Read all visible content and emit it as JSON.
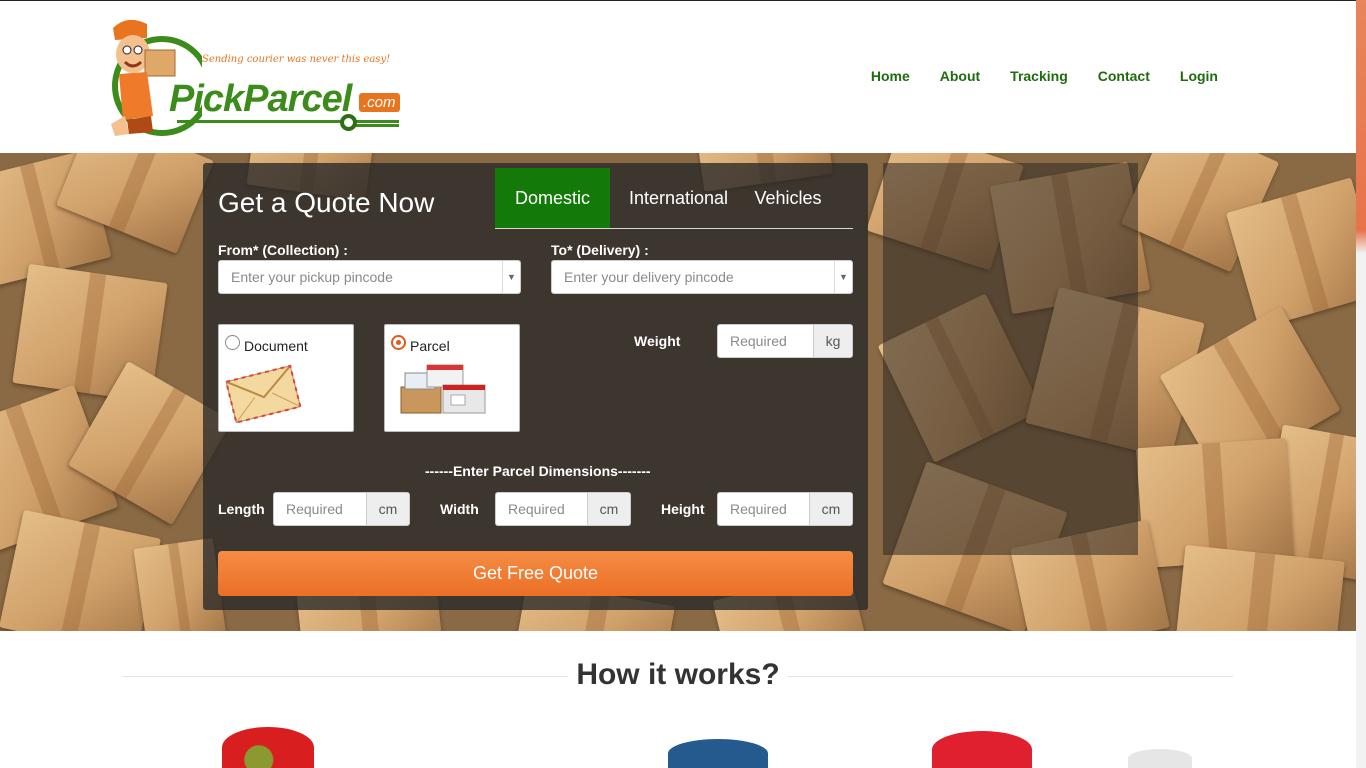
{
  "header": {
    "logo": {
      "tagline": "Sending courier was never this easy!",
      "brand": "PickParcel",
      "domain_suffix": ".com",
      "colors": {
        "green": "#3c8c1c",
        "orange": "#e8741f"
      }
    },
    "nav": [
      "Home",
      "About",
      "Tracking",
      "Contact",
      "Login"
    ]
  },
  "quote": {
    "title": "Get a Quote Now",
    "tabs": [
      "Domestic",
      "International",
      "Vehicles"
    ],
    "active_tab": "Domestic",
    "from": {
      "label": "From* (Collection) :",
      "placeholder": "Enter your pickup pincode"
    },
    "to": {
      "label": "To* (Delivery) :",
      "placeholder": "Enter your delivery pincode"
    },
    "types": [
      {
        "label": "Document",
        "checked": false,
        "icon": "envelope-icon"
      },
      {
        "label": "Parcel",
        "checked": true,
        "icon": "parcel-boxes-icon"
      }
    ],
    "weight": {
      "label": "Weight",
      "placeholder": "Required",
      "unit": "kg"
    },
    "dimensions_title": "------Enter Parcel Dimensions-------",
    "length": {
      "label": "Length",
      "placeholder": "Required",
      "unit": "cm"
    },
    "width": {
      "label": "Width",
      "placeholder": "Required",
      "unit": "cm"
    },
    "height": {
      "label": "Height",
      "placeholder": "Required",
      "unit": "cm"
    },
    "submit": "Get Free Quote",
    "colors": {
      "active_tab": "#137a0a",
      "button": "#ec6f26"
    }
  },
  "how": {
    "title": "How it works?"
  }
}
